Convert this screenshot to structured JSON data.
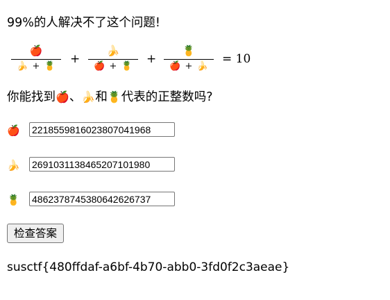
{
  "title": "99%的人解决不了这个问题!",
  "equation": {
    "fractions": [
      {
        "numerator": "🍎",
        "denominator_left": "🍌",
        "denominator_plus": "+",
        "denominator_right": "🍍"
      },
      {
        "numerator": "🍌",
        "denominator_left": "🍎",
        "denominator_plus": "+",
        "denominator_right": "🍍"
      },
      {
        "numerator": "🍍",
        "denominator_left": "🍎",
        "denominator_plus": "+",
        "denominator_right": "🍌"
      }
    ],
    "plus_1": "+",
    "plus_2": "+",
    "equals": "= 10"
  },
  "question": {
    "prefix": "你能找到",
    "apple": "🍎",
    "separator": "、",
    "banana": "🍌",
    "conjunction": "和",
    "pineapple": "🍍",
    "suffix": "代表的正整数吗?"
  },
  "answers": {
    "apple": {
      "icon": "🍎",
      "value": "2218559816023807041968"
    },
    "banana": {
      "icon": "🍌",
      "value": "2691031138465207101980"
    },
    "pineapple": {
      "icon": "🍍",
      "value": "4862378745380642626737"
    }
  },
  "check_button_label": "检查答案",
  "flag": "susctf{480ffdaf-a6bf-4b70-abb0-3fd0f2c3aeae}"
}
